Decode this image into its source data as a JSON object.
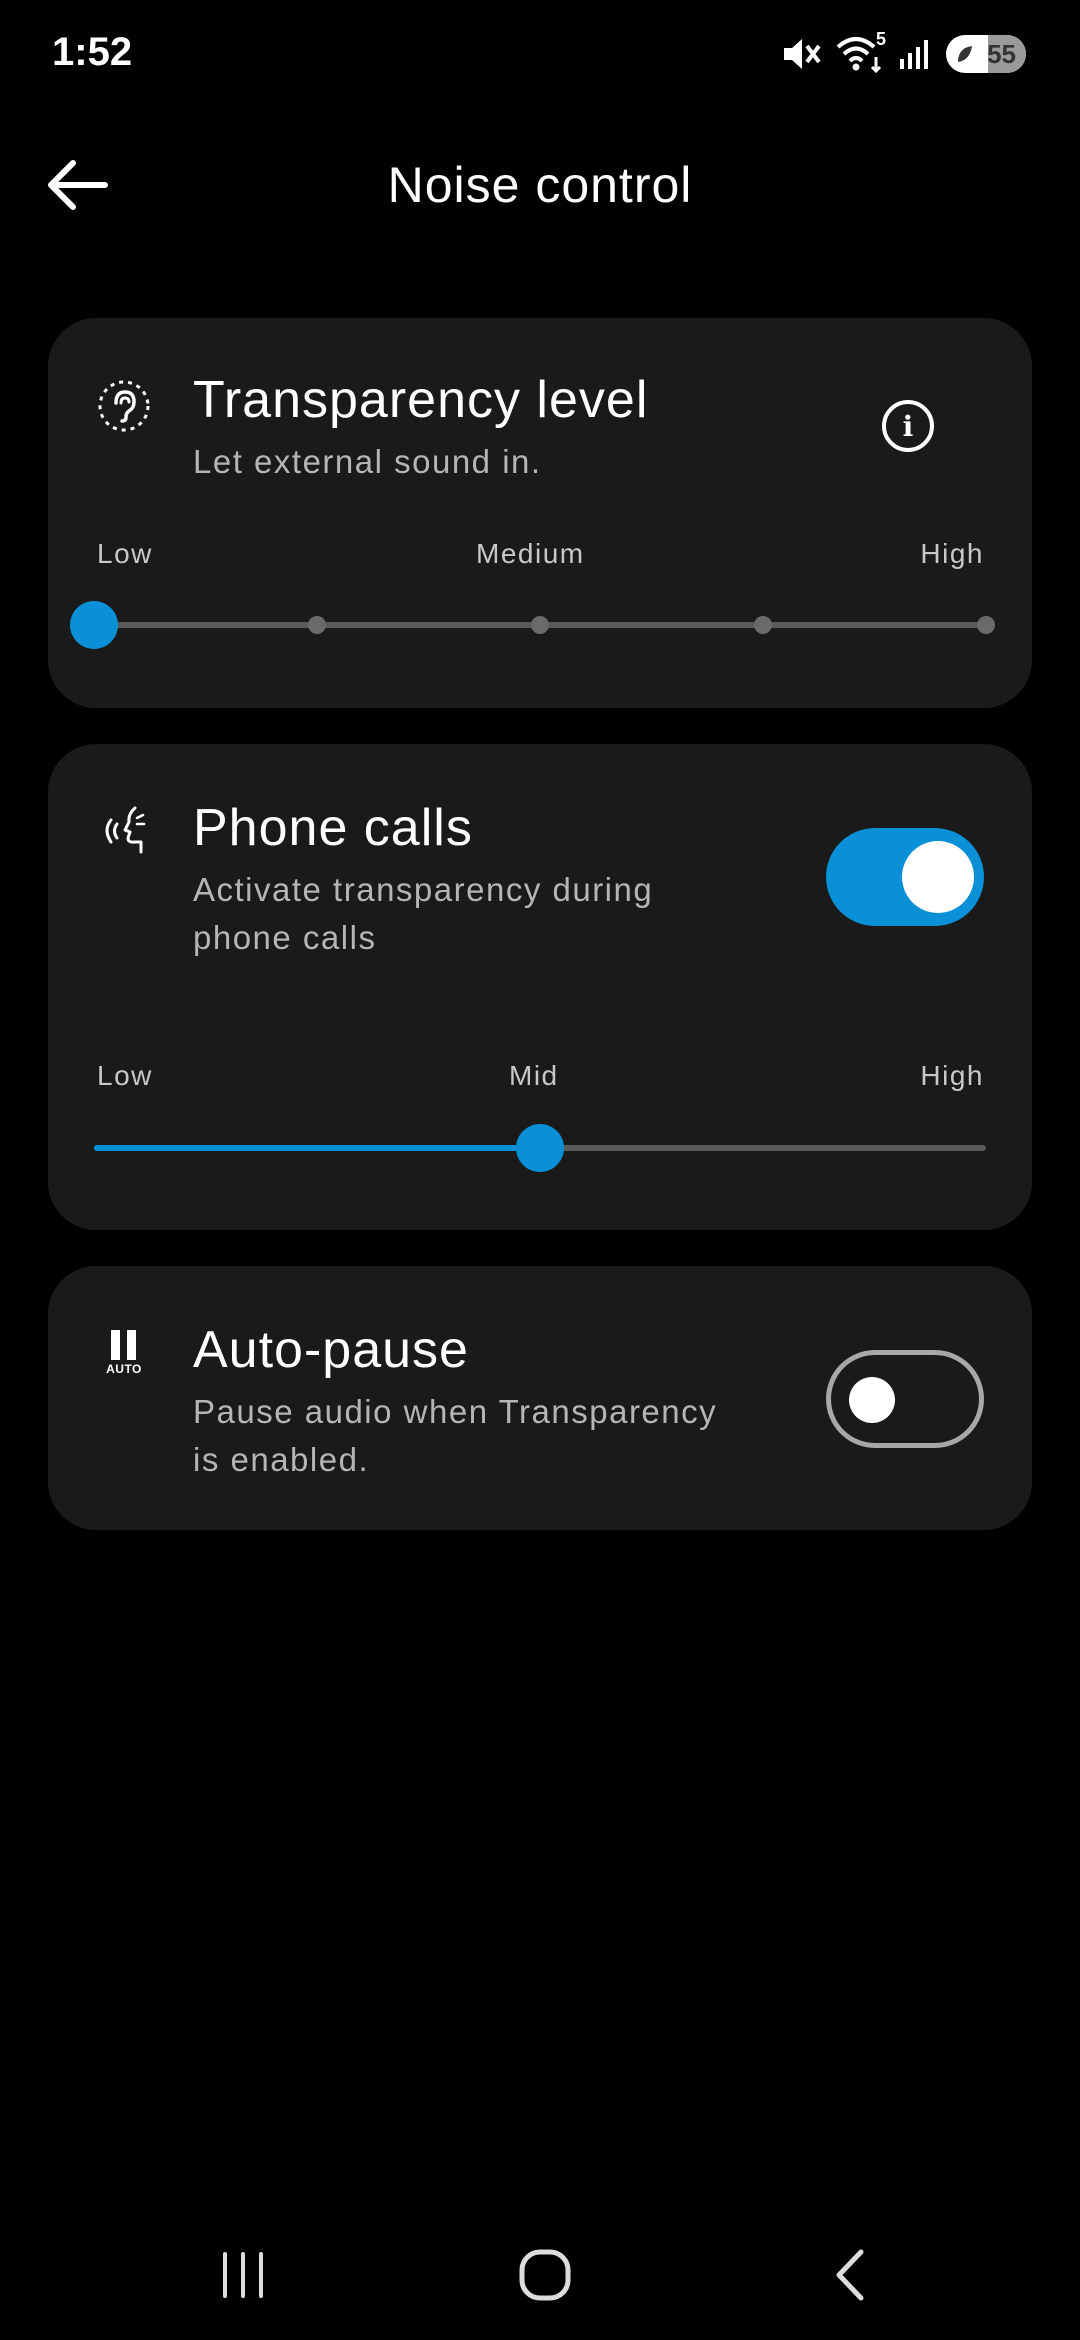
{
  "status_bar": {
    "time": "1:52",
    "wifi_badge": "5",
    "battery": "55",
    "icons": [
      "mute-icon",
      "wifi-icon",
      "signal-icon",
      "battery-icon"
    ]
  },
  "header": {
    "title": "Noise control",
    "back_icon": "arrow-left-icon"
  },
  "transparency": {
    "title": "Transparency level",
    "subtitle": "Let external sound in.",
    "icon": "ear-icon",
    "info_icon": "info-icon",
    "labels": {
      "low": "Low",
      "medium": "Medium",
      "high": "High"
    },
    "slider": {
      "steps": 5,
      "value_step": 0
    }
  },
  "phone_calls": {
    "title": "Phone calls",
    "subtitle_line1": "Activate transparency during",
    "subtitle_line2": "phone calls",
    "icon": "voice-wave-icon",
    "toggle_on": true,
    "labels": {
      "low": "Low",
      "mid": "Mid",
      "high": "High"
    },
    "slider": {
      "value_fraction": 0.5
    }
  },
  "auto_pause": {
    "title": "Auto-pause",
    "subtitle_line1": "Pause audio when Transparency",
    "subtitle_line2": "is enabled.",
    "icon": "pause-auto-icon",
    "icon_text": "AUTO",
    "toggle_on": false
  },
  "nav_bar": {
    "items": [
      "recents-icon",
      "home-icon",
      "back-icon"
    ]
  },
  "colors": {
    "accent": "#0a90d6",
    "card": "#1a1a1a",
    "background": "#000000"
  }
}
